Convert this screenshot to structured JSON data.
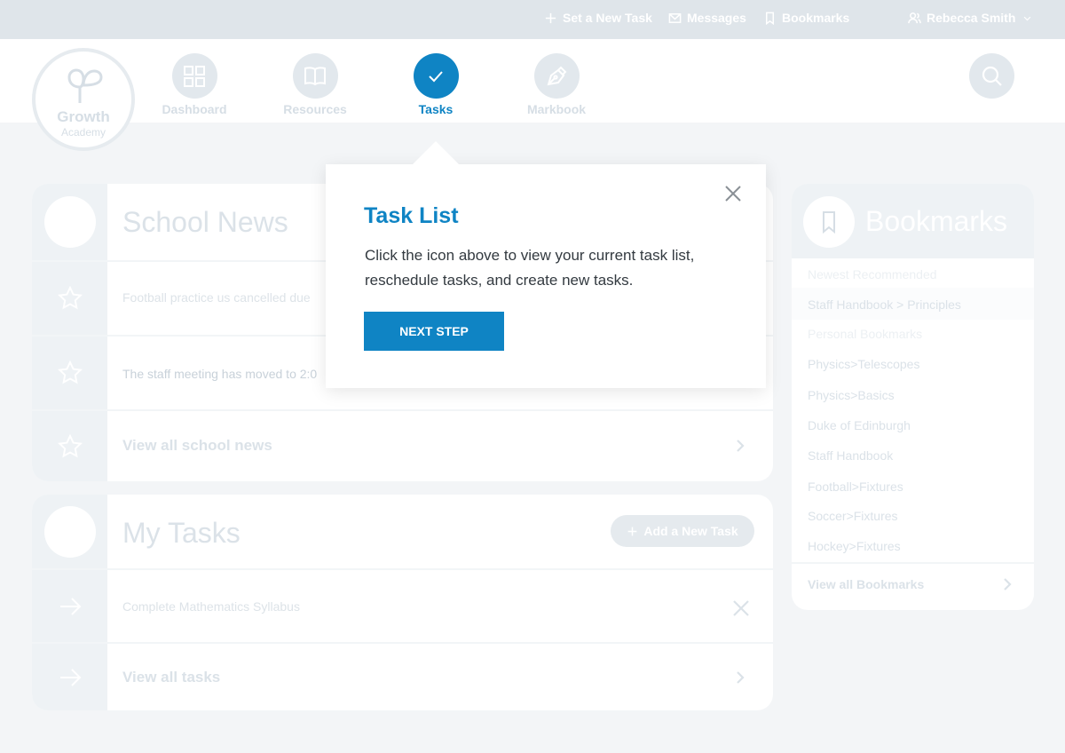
{
  "topbar": {
    "new_task": "Set a New Task",
    "messages": "Messages",
    "bookmarks": "Bookmarks",
    "user": "Rebecca Smith"
  },
  "logo": {
    "line1": "Growth",
    "line2": "Academy"
  },
  "nav": {
    "dashboard": "Dashboard",
    "resources": "Resources",
    "tasks": "Tasks",
    "markbook": "Markbook"
  },
  "news": {
    "title": "School News",
    "items": [
      "Football practice us cancelled due",
      "The staff meeting has moved to 2:0"
    ],
    "view_all": "View all school news"
  },
  "tasks": {
    "title": "My Tasks",
    "add_label": "Add a New Task",
    "items": [
      "Complete Mathematics Syllabus"
    ],
    "view_all": "View all tasks"
  },
  "bookmarks": {
    "title": "Bookmarks",
    "section_recommended": "Newest Recommended",
    "recommended": [
      "Staff Handbook > Principles"
    ],
    "section_personal": "Personal Bookmarks",
    "personal": [
      "Physics>Telescopes",
      "Physics>Basics",
      "Duke of Edinburgh",
      "Staff Handbook",
      "Football>Fixtures",
      "Soccer>Fixtures",
      "Hockey>Fixtures"
    ],
    "view_all": "View all Bookmarks"
  },
  "popup": {
    "title": "Task List",
    "body": "Click the icon above to view your current task list, reschedule tasks, and create new tasks.",
    "next_label": "NEXT STEP"
  },
  "colors": {
    "accent": "#0f84c4",
    "muted": "#dfe5ea"
  }
}
